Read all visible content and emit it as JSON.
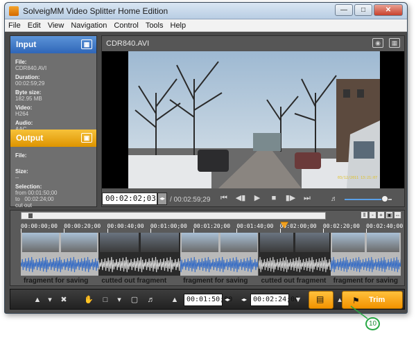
{
  "window": {
    "title": "SolveigMM Video Splitter Home Edition"
  },
  "menu": [
    "File",
    "Edit",
    "View",
    "Navigation",
    "Control",
    "Tools",
    "Help"
  ],
  "input_panel": {
    "header": "Input",
    "file_label": "File:",
    "file_value": "CDR840.AVI",
    "duration_label": "Duration:",
    "duration_value": "00:02:59;29",
    "bytesize_label": "Byte size:",
    "bytesize_value": "182.95 MB",
    "video_label": "Video:",
    "video_value": "H264",
    "audio_label": "Audio:",
    "audio_value": "AAC"
  },
  "output_panel": {
    "header": "Output",
    "file_label": "File:",
    "size_label": "Size:",
    "size_value": "--",
    "selection_label": "Selection:",
    "from_label": "from",
    "from_value": "00:01:50;00",
    "to_label": "to",
    "to_value": "00:02:24;00",
    "status": "cut out"
  },
  "viewer": {
    "filename": "CDR840.AVI",
    "current_time": "00:02:02;03",
    "total_time": "/ 00:02:59;29",
    "overlay_date": "03/12/2011 13:21:07",
    "volume": 0.85
  },
  "timeline": {
    "ticks": [
      "00:00:00;00",
      "00:00:20;00",
      "00:00:40;00",
      "00:01:00;00",
      "00:01:20;00",
      "00:01:40;00",
      "00:02:00;00",
      "00:02:20;00",
      "00:02:40;00"
    ],
    "playhead_time": "00:02:02;03",
    "segments": [
      {
        "label": "fragment for saving",
        "kind": "save"
      },
      {
        "label": "cutted out fragment",
        "kind": "cut"
      },
      {
        "label": "fragment for saving",
        "kind": "save"
      },
      {
        "label": "cutted out fragment",
        "kind": "cut"
      },
      {
        "label": "fragment for saving",
        "kind": "save"
      }
    ]
  },
  "toolbar": {
    "start_time": "00:01:50;00",
    "end_time": "00:02:24;00",
    "trim_label": "Trim"
  },
  "callout": "10",
  "colors": {
    "accent_blue": "#2f66b8",
    "accent_orange": "#f29200",
    "callout_green": "#27a844"
  }
}
